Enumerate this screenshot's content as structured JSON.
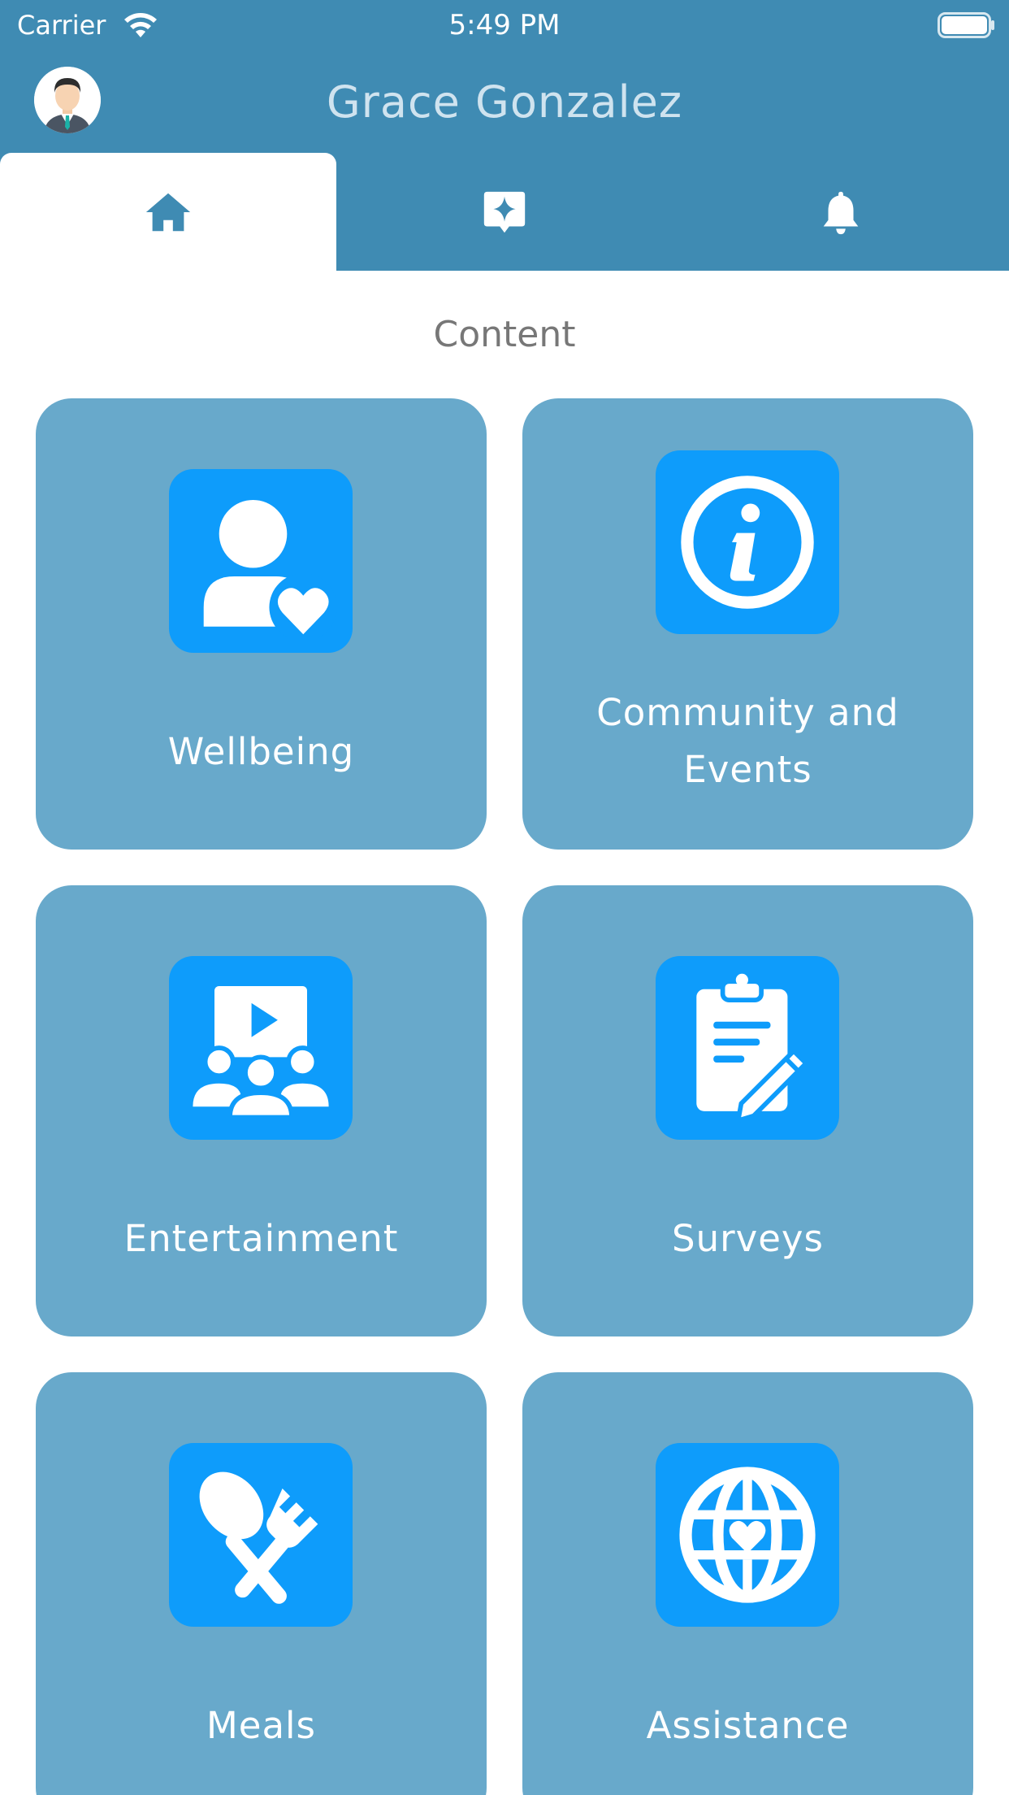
{
  "status_bar": {
    "carrier": "Carrier",
    "time": "5:49 PM"
  },
  "header": {
    "user_name": "Grace Gonzalez",
    "avatar_icon": "user-avatar-icon"
  },
  "tabs": [
    {
      "icon": "home-icon",
      "active": true
    },
    {
      "icon": "sparkle-badge-icon",
      "active": false
    },
    {
      "icon": "bell-icon",
      "active": false
    }
  ],
  "content": {
    "title": "Content",
    "cards": [
      {
        "label": "Wellbeing",
        "icon": "person-heart-icon"
      },
      {
        "label": "Community and Events",
        "icon": "info-circle-icon"
      },
      {
        "label": "Entertainment",
        "icon": "video-audience-icon"
      },
      {
        "label": "Surveys",
        "icon": "clipboard-pencil-icon"
      },
      {
        "label": "Meals",
        "icon": "spoon-fork-icon"
      },
      {
        "label": "Assistance",
        "icon": "globe-heart-icon"
      }
    ]
  },
  "colors": {
    "header": "#3f8bb3",
    "card": "#68a9cb",
    "icon_box": "#0e9cfb"
  }
}
